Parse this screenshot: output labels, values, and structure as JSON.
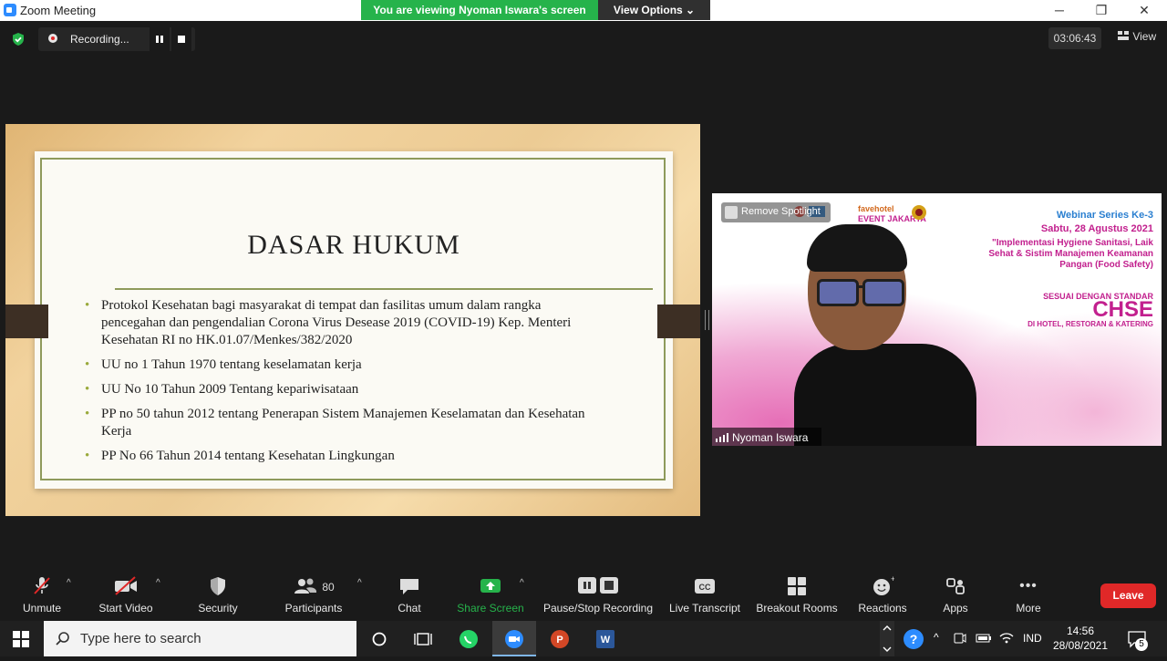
{
  "window": {
    "title": "Zoom Meeting",
    "minimize": "─",
    "maximize": "❐",
    "close": "✕"
  },
  "banner": {
    "viewing": "You are viewing Nyoman Iswara's screen",
    "view_options": "View Options ⌄"
  },
  "recording": {
    "label": "Recording..."
  },
  "timer": "03:06:43",
  "view_button": "View",
  "slide": {
    "title": "DASAR HUKUM",
    "bullets": [
      "Protokol Kesehatan bagi masyarakat di tempat dan fasilitas umum dalam rangka pencegahan dan pengendalian Corona Virus Desease 2019 (COVID-19) Kep. Menteri Kesehatan RI no HK.01.07/Menkes/382/2020",
      "UU no 1 Tahun 1970 tentang keselamatan kerja",
      "UU No 10 Tahun 2009 Tentang kepariwisataan",
      "PP no 50 tahun 2012 tentang Penerapan Sistem Manajemen Keselamatan dan Kesehatan Kerja",
      "PP No 66 Tahun 2014 tentang Kesehatan Lingkungan"
    ]
  },
  "video": {
    "spotlight": "Remove Spotlight",
    "participant_name": "Nyoman Iswara",
    "logos": [
      "favehotel",
      "EVENT JAKARTA"
    ],
    "webinar_series": "Webinar Series Ke-3",
    "date": "Sabtu, 28 Agustus 2021",
    "topic": "\"Implementasi Hygiene Sanitasi, Laik Sehat & Sistim Manajemen Keamanan Pangan (Food Safety)",
    "standard": "SESUAI DENGAN STANDAR",
    "chse": "CHSE",
    "venues": "DI HOTEL, RESTORAN & KATERING"
  },
  "toolbar": {
    "unmute": "Unmute",
    "start_video": "Start Video",
    "security": "Security",
    "participants": "Participants",
    "participants_count": "80",
    "chat": "Chat",
    "share_screen": "Share Screen",
    "pause_stop": "Pause/Stop Recording",
    "live_transcript": "Live Transcript",
    "cc": "CC",
    "breakout": "Breakout Rooms",
    "reactions": "Reactions",
    "apps": "Apps",
    "more": "More",
    "more_icon": "•••",
    "leave": "Leave"
  },
  "taskbar": {
    "search_placeholder": "Type here to search",
    "lang": "IND",
    "time": "14:56",
    "date": "28/08/2021",
    "notifications": "5"
  },
  "colors": {
    "share_green": "#26b34b",
    "leave_red": "#e02828",
    "zoom_blue": "#2d8cff"
  }
}
